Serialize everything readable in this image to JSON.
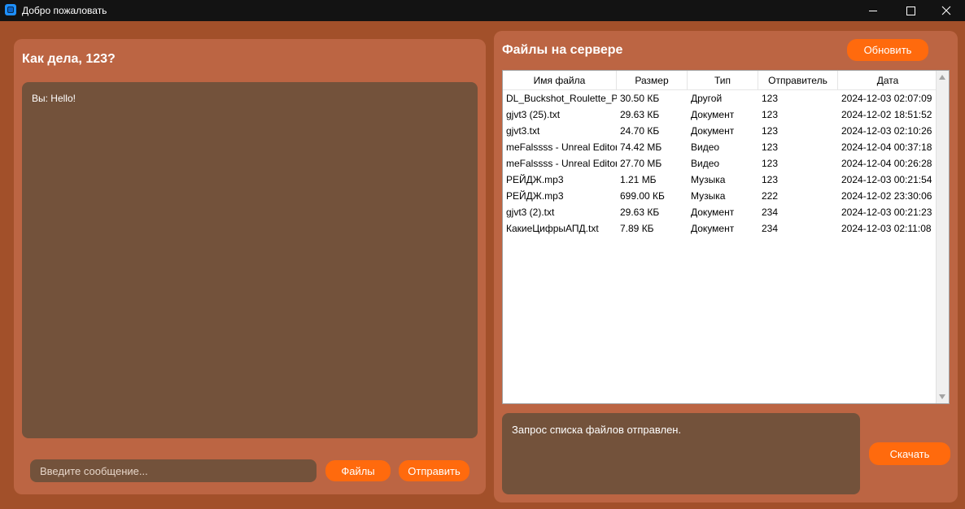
{
  "window": {
    "title": "Добро пожаловать",
    "icon": "app-icon"
  },
  "colors": {
    "background": "#a2502a",
    "panel": "#bc6543",
    "dark_box": "#73523b",
    "accent": "#ff6a0d",
    "titlebar": "#131313"
  },
  "chat": {
    "heading": "Как дела, 123?",
    "messages": [
      "Вы: Hello!"
    ],
    "input_placeholder": "Введите сообщение...",
    "files_button": "Файлы",
    "send_button": "Отправить"
  },
  "files": {
    "heading": "Файлы на сервере",
    "refresh_button": "Обновить",
    "columns": [
      "Имя файла",
      "Размер",
      "Тип",
      "Отправитель",
      "Дата"
    ],
    "rows": [
      [
        "DL_Buckshot_Roulette_P",
        "30.50 КБ",
        "Другой",
        "123",
        "2024-12-03 02:07:09"
      ],
      [
        "gjvt3 (25).txt",
        "29.63 КБ",
        "Документ",
        "123",
        "2024-12-02 18:51:52"
      ],
      [
        "gjvt3.txt",
        "24.70 КБ",
        "Документ",
        "123",
        "2024-12-03 02:10:26"
      ],
      [
        "meFalssss - Unreal Editor",
        "74.42 МБ",
        "Видео",
        "123",
        "2024-12-04 00:37:18"
      ],
      [
        "meFalssss - Unreal Editor",
        "27.70 МБ",
        "Видео",
        "123",
        "2024-12-04 00:26:28"
      ],
      [
        "РЕЙДЖ.mp3",
        "1.21 МБ",
        "Музыка",
        "123",
        "2024-12-03 00:21:54"
      ],
      [
        "РЕЙДЖ.mp3",
        "699.00 КБ",
        "Музыка",
        "222",
        "2024-12-02 23:30:06"
      ],
      [
        "gjvt3 (2).txt",
        "29.63 КБ",
        "Документ",
        "234",
        "2024-12-03 00:21:23"
      ],
      [
        "КакиеЦифрыАПД.txt",
        "7.89 КБ",
        "Документ",
        "234",
        "2024-12-03 02:11:08"
      ]
    ],
    "status": "Запрос списка файлов отправлен.",
    "download_button": "Скачать"
  }
}
